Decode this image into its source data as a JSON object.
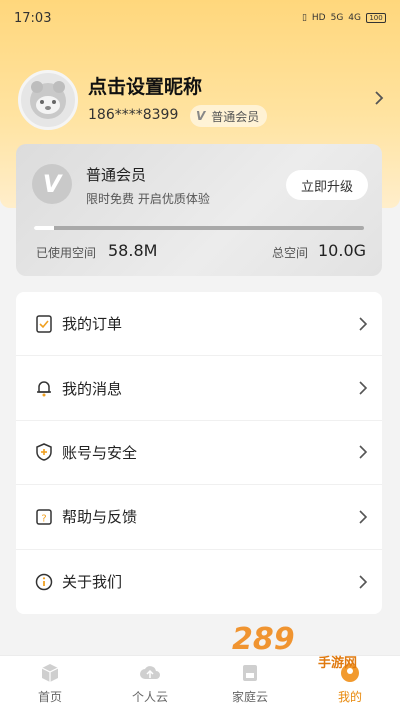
{
  "status_bar": {
    "time": "17:03",
    "hd": "HD",
    "net1": "5G",
    "net2": "4G",
    "battery": "100"
  },
  "profile": {
    "nickname": "点击设置昵称",
    "phone": "186****8399",
    "member_level": "普通会员"
  },
  "membership_card": {
    "title": "普通会员",
    "subtitle": "限时免费 开启优质体验",
    "upgrade_label": "立即升级",
    "used_label": "已使用空间",
    "used_value": "58.8M",
    "total_label": "总空间",
    "total_value": "10.0G",
    "usage_fraction": 0.01
  },
  "menu": {
    "items": [
      {
        "label": "我的订单",
        "icon": "order-icon"
      },
      {
        "label": "我的消息",
        "icon": "bell-icon"
      },
      {
        "label": "账号与安全",
        "icon": "shield-icon"
      },
      {
        "label": "帮助与反馈",
        "icon": "help-icon"
      },
      {
        "label": "关于我们",
        "icon": "info-icon"
      }
    ]
  },
  "bottom_nav": {
    "items": [
      {
        "label": "首页",
        "icon": "home-cube-icon"
      },
      {
        "label": "个人云",
        "icon": "cloud-upload-icon"
      },
      {
        "label": "家庭云",
        "icon": "family-cloud-icon"
      },
      {
        "label": "我的",
        "icon": "me-icon",
        "active": true
      }
    ]
  },
  "watermark": {
    "text": "289",
    "sub": "手游网"
  },
  "colors": {
    "header": "#ffd77c",
    "accent": "#e8890c",
    "card": "#e6e6e6"
  }
}
